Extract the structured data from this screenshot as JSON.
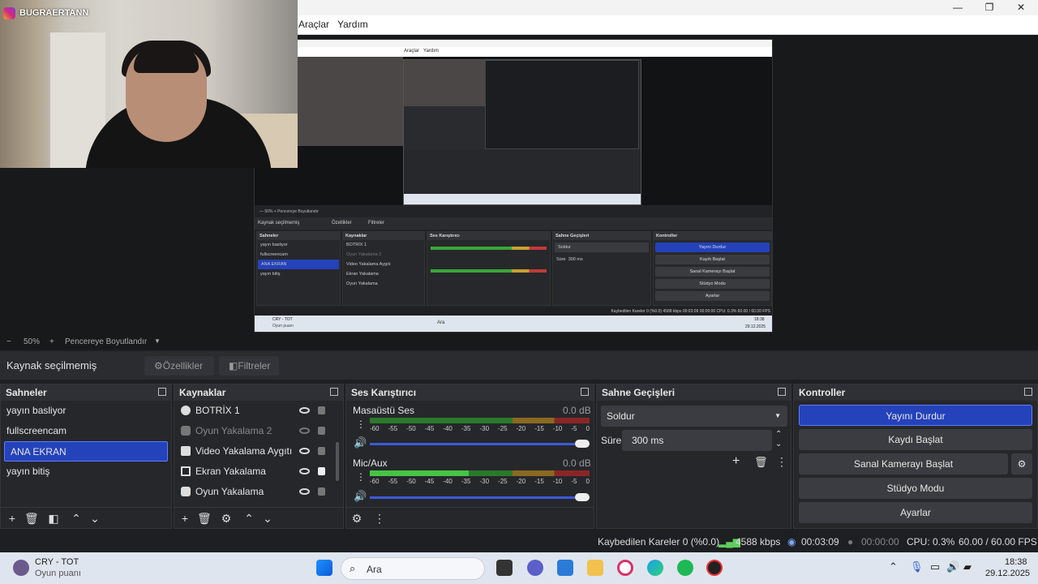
{
  "webcam": {
    "handle": "BUGRAERTANN"
  },
  "menu": {
    "tools": "Araçlar",
    "help": "Yardım"
  },
  "mirror": {
    "menu": [
      "Araçlar",
      "Yardım"
    ],
    "zoom": "—   50%   +   Pencereye Boyutlandır",
    "no_source": "Kaynak seçilmemiş",
    "props": "Özellikler",
    "filters": "Filtreler",
    "docks": {
      "scenes": "Sahneler",
      "sources": "Kaynaklar",
      "mixer": "Ses Karıştırıcı",
      "transitions": "Sahne Geçişleri",
      "controls": "Kontroller"
    },
    "scenes": [
      "yayın basliyor",
      "fullscreencam",
      "ANA EKRAN",
      "yayın bitiş"
    ],
    "sources": [
      "BOTRİX 1",
      "Oyun Yakalama 2",
      "Video Yakalama Aygıtı",
      "Ekran Yakalama",
      "Oyun Yakalama"
    ],
    "controls": [
      "Yayını Durdur",
      "Kaydı Başlat",
      "Sanal Kamerayı Başlat",
      "Stüdyo Modu",
      "Ayarlar"
    ],
    "transition": "Soldur",
    "duration_label": "Süre",
    "duration": "300 ms",
    "status": "Kaybedilen Kareler 0 (%0.0)   4588 kbps   00:03:09   00:00:00   CPU: 0.3%   60.00 / 60.00 FPS",
    "task_song": "CRY - TOT",
    "task_sub": "Oyun puanı",
    "search": "Ara",
    "time": "18:38",
    "date": "29.12.2025"
  },
  "zoom": {
    "minus": "−",
    "level": "50%",
    "plus": "+",
    "fit": "Pencereye Boyutlandır",
    "arrow": "▼"
  },
  "source_bar": {
    "no_source": "Kaynak seçilmemiş",
    "properties": "Özellikler",
    "filters": "Filtreler"
  },
  "scenes": {
    "title": "Sahneler",
    "items": [
      "yayın basliyor",
      "fullscreencam",
      "ANA EKRAN",
      "yayın bitiş"
    ],
    "selected_index": 2
  },
  "sources": {
    "title": "Kaynaklar",
    "items": [
      {
        "label": "BOTRİX 1",
        "visible": true,
        "locked": false
      },
      {
        "label": "Oyun Yakalama 2",
        "visible": false,
        "locked": false
      },
      {
        "label": "Video Yakalama Aygıtı",
        "visible": true,
        "locked": false
      },
      {
        "label": "Ekran Yakalama",
        "visible": true,
        "locked": true
      },
      {
        "label": "Oyun Yakalama",
        "visible": true,
        "locked": false
      }
    ]
  },
  "mixer": {
    "title": "Ses Karıştırıcı",
    "channels": [
      {
        "name": "Masaüstü Ses",
        "db": "0.0 dB"
      },
      {
        "name": "Mic/Aux",
        "db": "0.0 dB"
      }
    ],
    "scale": [
      "-60",
      "-55",
      "-50",
      "-45",
      "-40",
      "-35",
      "-30",
      "-25",
      "-20",
      "-15",
      "-10",
      "-5",
      "0"
    ]
  },
  "transitions": {
    "title": "Sahne Geçişleri",
    "selected": "Soldur",
    "duration_label": "Süre",
    "duration": "300 ms"
  },
  "controls": {
    "title": "Kontroller",
    "stream": "Yayını Durdur",
    "record": "Kaydı Başlat",
    "virtualcam": "Sanal Kamerayı Başlat",
    "studio": "Stüdyo Modu",
    "settings": "Ayarlar"
  },
  "status": {
    "dropped": "Kaybedilen Kareler 0 (%0.0)",
    "bitrate": "4588 kbps",
    "stream_time": "00:03:09",
    "rec_time": "00:00:00",
    "cpu": "CPU: 0.3%",
    "fps": "60.00 / 60.00 FPS"
  },
  "taskbar": {
    "song": "CRY - TOT",
    "subtitle": "Oyun puanı",
    "search": "Ara",
    "time": "18:38",
    "date": "29.12.2025"
  },
  "colors": {
    "accent": "#2442ba",
    "meter_green": "#3aa63a",
    "meter_yellow": "#c8a030",
    "meter_red": "#c03a3a"
  }
}
